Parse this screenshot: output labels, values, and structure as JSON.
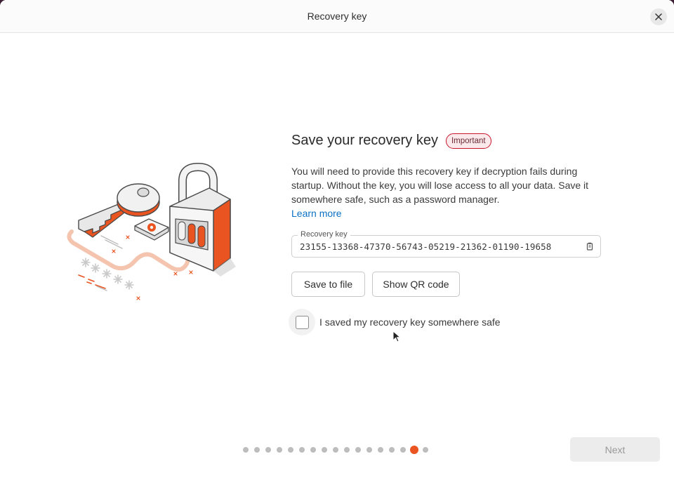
{
  "window": {
    "title": "Recovery key"
  },
  "page": {
    "heading": "Save your recovery key",
    "badge": "Important",
    "description": "You will need to provide this recovery key if decryption fails during startup. Without the key, you will lose access to all your data. Save it somewhere safe, such as a password manager.",
    "learn_more": "Learn more"
  },
  "recovery_key": {
    "label": "Recovery key",
    "value": "23155-13368-47370-56743-05219-21362-01190-19658",
    "copy_icon": "copy-icon"
  },
  "buttons": {
    "save_to_file": "Save to file",
    "show_qr_code": "Show QR code",
    "next": "Next"
  },
  "confirm": {
    "label": "I saved my recovery key somewhere safe",
    "checked": false
  },
  "pager": {
    "total": 17,
    "current": 16
  },
  "colors": {
    "accent": "#e95420",
    "link": "#0b71c5",
    "badge_border": "#c7162b"
  }
}
